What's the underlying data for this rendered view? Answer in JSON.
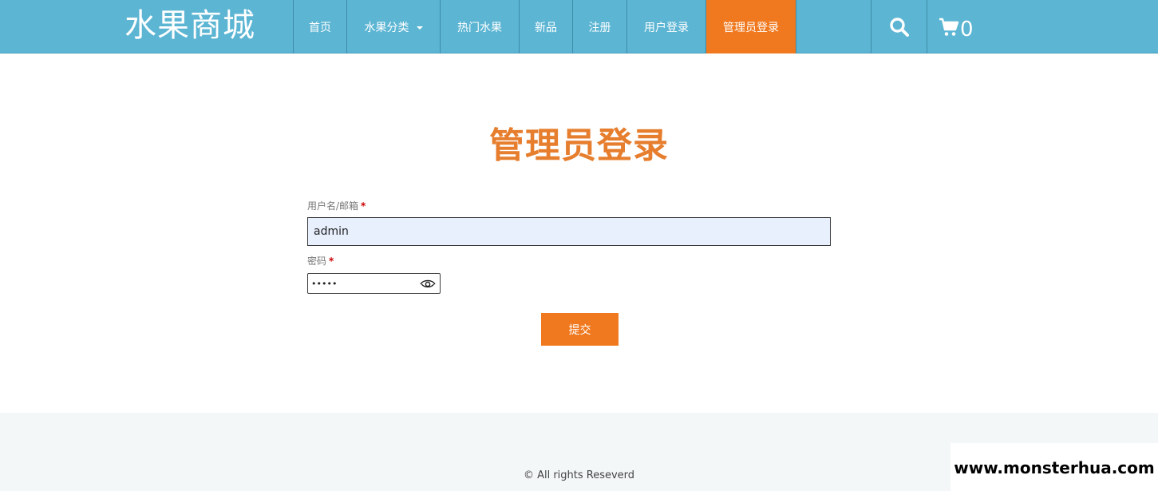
{
  "header": {
    "brand": "水果商城",
    "nav": [
      {
        "label": "首页"
      },
      {
        "label": "水果分类"
      },
      {
        "label": "热门水果"
      },
      {
        "label": "新品"
      },
      {
        "label": "注册"
      },
      {
        "label": "用户登录"
      },
      {
        "label": "管理员登录",
        "active": true
      }
    ],
    "search_icon": "search-icon",
    "cart_icon": "cart-icon",
    "cart_count": "0",
    "colors": {
      "bar": "#5bb5d3",
      "active": "#f0791f"
    }
  },
  "main": {
    "title": "管理员登录",
    "username_label": "用户名/邮箱",
    "username_value": "admin",
    "password_label": "密码",
    "password_value": "•••••",
    "required_mark": "*",
    "submit_label": "提交"
  },
  "footer": {
    "copyright": "© All rights Reseverd",
    "watermark": "www.monsterhua.com"
  }
}
